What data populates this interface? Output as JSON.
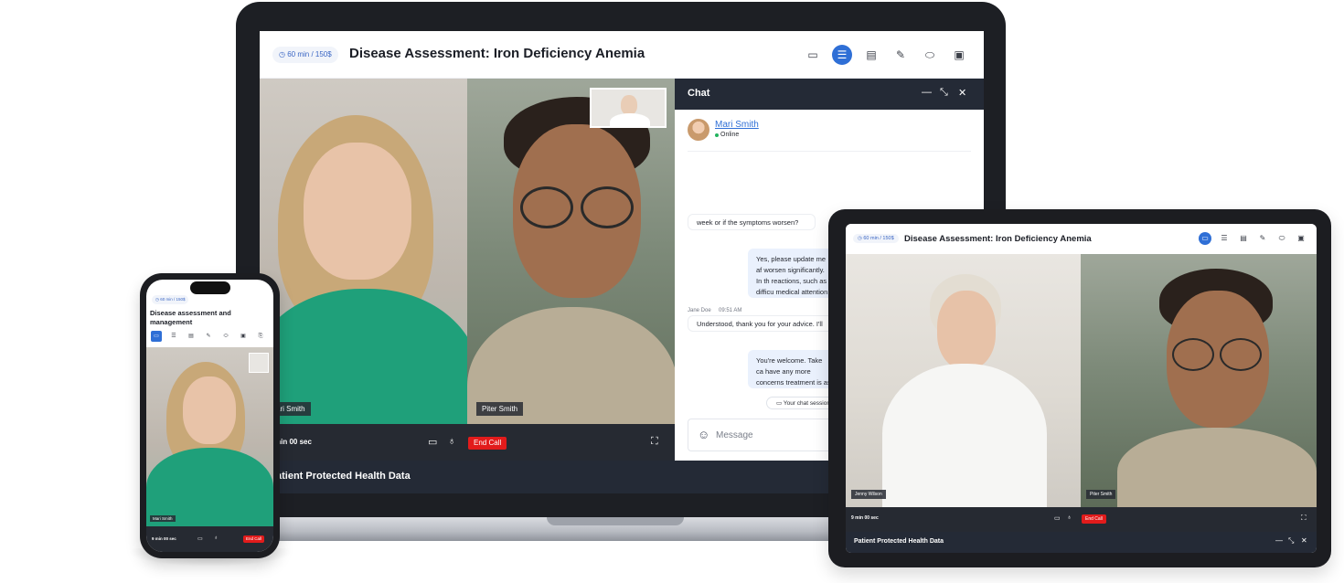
{
  "laptop": {
    "price": "60 min / 150$",
    "title": "Disease Assessment: Iron Deficiency Anemia",
    "tools": [
      "video-icon",
      "chat-icon",
      "document-icon",
      "prescription-icon",
      "pill-icon",
      "clipboard-icon"
    ],
    "video_left_name": "ari Smith",
    "video_right_name": "Piter Smith",
    "timer": "min 00 sec",
    "end_call": "End Call",
    "phi_label": "atient Protected Health Data",
    "chat": {
      "title": "Chat",
      "contact_name": "Mari Smith",
      "contact_status": "Online",
      "messages": [
        {
          "side": "in",
          "text": "week or if the symptoms worsen?"
        },
        {
          "side": "out",
          "text": "Yes, please update me af worsen significantly. In th reactions, such as difficu medical attention."
        },
        {
          "side": "in",
          "sender": "Jane Doe",
          "time": "09:51 AM",
          "text": "Understood, thank you for your advice. I'll kee"
        },
        {
          "side": "out",
          "text": "You're welcome. Take ca have any more concerns treatment is as effective"
        }
      ],
      "session_note": "Your chat session",
      "input_placeholder": "Message"
    }
  },
  "tablet": {
    "price": "60 min / 150$",
    "title": "Disease Assessment: Iron Deficiency Anemia",
    "left_name": "Jenny Wilson",
    "right_name": "Piter Smith",
    "timer": "9 min 00 sec",
    "end_call": "End Call",
    "phi_label": "Patient Protected Health Data"
  },
  "phone": {
    "price": "60 min / 150$",
    "title": "Disease assessment and management",
    "name": "Mari Smith",
    "timer": "9 min 00 sec",
    "end_call": "End Call"
  },
  "colors": {
    "accent": "#2f6fd6",
    "dark_bar": "#242a36",
    "end_call": "#e21b1b",
    "online": "#22b35e"
  }
}
